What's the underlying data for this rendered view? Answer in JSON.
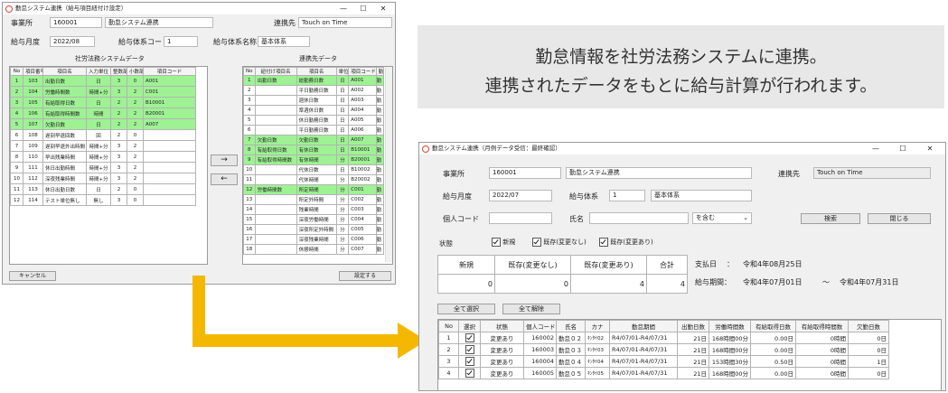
{
  "arrow_color": "#f5b800",
  "w1": {
    "title": "勤怠システム連携（給与項目紐付け設定）",
    "ctrls": [
      "—",
      "☐",
      "✕"
    ],
    "office_label": "事業所",
    "office_code": "160001",
    "office_name": "勤怠システム連携",
    "link_label": "連携先",
    "link_value": "Touch on Time",
    "month_label": "給与月度",
    "month_value": "2022/08",
    "sys_label": "給与体系コード",
    "sys_value": "1",
    "sysname_label": "給与体系名称",
    "sysname_value": "基本体系",
    "left_title": "社労法務システムデータ",
    "right_title": "連携先データ",
    "left_headers": [
      "No",
      "項目番号",
      "項目名",
      "入力単位",
      "整数部",
      "小数部",
      "項目コード"
    ],
    "left_rows": [
      {
        "no": "1",
        "num": "103",
        "name": "出勤日数",
        "unit": "日",
        "int": "3",
        "dec": "0",
        "code": "A001",
        "g": true
      },
      {
        "no": "2",
        "num": "104",
        "name": "労働時間数",
        "unit": "時間+分",
        "int": "3",
        "dec": "2",
        "code": "C001",
        "g": true
      },
      {
        "no": "3",
        "num": "105",
        "name": "有給取得日数",
        "unit": "日",
        "int": "2",
        "dec": "2",
        "code": "B10001",
        "g": true
      },
      {
        "no": "4",
        "num": "106",
        "name": "有給取得時間数",
        "unit": "時間",
        "int": "2",
        "dec": "2",
        "code": "B20001",
        "g": true
      },
      {
        "no": "5",
        "num": "107",
        "name": "欠勤日数",
        "unit": "日",
        "int": "2",
        "dec": "2",
        "code": "A007",
        "g": true
      },
      {
        "no": "6",
        "num": "108",
        "name": "遅刻早退回数",
        "unit": "回",
        "int": "2",
        "dec": "0",
        "code": "",
        "g": false
      },
      {
        "no": "7",
        "num": "109",
        "name": "遅刻早退外出時間",
        "unit": "時間+分",
        "int": "3",
        "dec": "2",
        "code": "",
        "g": false
      },
      {
        "no": "8",
        "num": "110",
        "name": "早出残業時間",
        "unit": "時間+分",
        "int": "3",
        "dec": "2",
        "code": "",
        "g": false
      },
      {
        "no": "9",
        "num": "111",
        "name": "休日出勤時間",
        "unit": "時間+分",
        "int": "3",
        "dec": "2",
        "code": "",
        "g": false
      },
      {
        "no": "10",
        "num": "112",
        "name": "深夜残業時間",
        "unit": "時間+分",
        "int": "3",
        "dec": "2",
        "code": "",
        "g": false
      },
      {
        "no": "11",
        "num": "113",
        "name": "休日出勤日数",
        "unit": "日",
        "int": "2",
        "dec": "0",
        "code": "",
        "g": false
      },
      {
        "no": "12",
        "num": "114",
        "name": "テスト単位無し",
        "unit": "無し",
        "int": "3",
        "dec": "0",
        "code": "",
        "g": false
      }
    ],
    "right_headers": [
      "No",
      "紐付け項目名",
      "項目名",
      "単位",
      "項目コード",
      "勤"
    ],
    "right_rows": [
      {
        "no": "1",
        "link": "出勤日数",
        "name": "総勤務日数",
        "unit": "日",
        "code": "A001",
        "x": "勤",
        "g": true
      },
      {
        "no": "2",
        "link": "",
        "name": "平日勤務日数",
        "unit": "日",
        "code": "A002",
        "x": "勤",
        "g": false
      },
      {
        "no": "3",
        "link": "",
        "name": "週休日数",
        "unit": "日",
        "code": "A003",
        "x": "勤",
        "g": false
      },
      {
        "no": "4",
        "link": "",
        "name": "準週休日数",
        "unit": "日",
        "code": "A004",
        "x": "勤",
        "g": false
      },
      {
        "no": "5",
        "link": "",
        "name": "休日勤務日数",
        "unit": "日",
        "code": "A005",
        "x": "勤",
        "g": false
      },
      {
        "no": "6",
        "link": "",
        "name": "平日勤務日数",
        "unit": "日",
        "code": "A006",
        "x": "勤",
        "g": false
      },
      {
        "no": "7",
        "link": "欠勤日数",
        "name": "欠勤日数",
        "unit": "日",
        "code": "A007",
        "x": "勤",
        "g": true
      },
      {
        "no": "8",
        "link": "有給取得日数",
        "name": "有休日数",
        "unit": "日",
        "code": "B10001",
        "x": "勤",
        "g": true
      },
      {
        "no": "9",
        "link": "有給取得時間数",
        "name": "有休時間",
        "unit": "分",
        "code": "B20001",
        "x": "勤",
        "g": true
      },
      {
        "no": "10",
        "link": "",
        "name": "代休日数",
        "unit": "日",
        "code": "B10002",
        "x": "勤",
        "g": false
      },
      {
        "no": "11",
        "link": "",
        "name": "代休時間",
        "unit": "分",
        "code": "B20002",
        "x": "勤",
        "g": false
      },
      {
        "no": "12",
        "link": "労働時間数",
        "name": "所定時間",
        "unit": "分",
        "code": "C001",
        "x": "勤",
        "g": true
      },
      {
        "no": "13",
        "link": "",
        "name": "所定外時間",
        "unit": "分",
        "code": "C002",
        "x": "勤",
        "g": false
      },
      {
        "no": "14",
        "link": "",
        "name": "残業時間",
        "unit": "分",
        "code": "C003",
        "x": "勤",
        "g": false
      },
      {
        "no": "15",
        "link": "",
        "name": "深夜労働時間",
        "unit": "分",
        "code": "C004",
        "x": "勤",
        "g": false
      },
      {
        "no": "16",
        "link": "",
        "name": "深夜所定外時間",
        "unit": "分",
        "code": "C005",
        "x": "勤",
        "g": false
      },
      {
        "no": "17",
        "link": "",
        "name": "深夜残業時間",
        "unit": "分",
        "code": "C006",
        "x": "勤",
        "g": false
      },
      {
        "no": "18",
        "link": "",
        "name": "休憩時間",
        "unit": "分",
        "code": "C007",
        "x": "勤",
        "g": false
      }
    ],
    "move_right": "→",
    "move_left": "←",
    "cancel_label": "キャンセル",
    "save_label": "設定する"
  },
  "callout": {
    "line1": "勤怠情報を社労法務システムに連携。",
    "line2": "連携されたデータをもとに給与計算が行われます。"
  },
  "w2": {
    "title": "勤怠システム連携（月例データ受信：最終確認）",
    "ctrls": [
      "—",
      "☐",
      "✕"
    ],
    "office_label": "事業所",
    "office_code": "160001",
    "office_name": "勤怠システム連携",
    "link_label": "連携先",
    "link_value": "Touch on Time",
    "month_label": "給与月度",
    "month_value": "2022/07",
    "sys_label": "給与体系",
    "sys_value": "1",
    "sys_name": "基本体系",
    "person_label": "個人コード",
    "name_label": "氏名",
    "match_value": "を含む",
    "search_label": "検索",
    "close_label": "閉じる",
    "status_label": "状態",
    "checks": [
      "新規",
      "既存(変更なし)",
      "既存(変更あり)"
    ],
    "summary_headers": [
      "新規",
      "既存(変更なし)",
      "既存(変更あり)",
      "合計"
    ],
    "summary_values": [
      "0",
      "0",
      "4",
      "4"
    ],
    "pay_label": "支払日",
    "pay_colon": "：",
    "pay_value": "令和4年08月25日",
    "period_label": "給与期間：",
    "period_from": "令和4年07月01日",
    "period_tilde": "〜",
    "period_to": "令和4年07月31日",
    "select_all": "全て選択",
    "clear_all": "全て解除",
    "headers": [
      "No",
      "選択",
      "状態",
      "個人コード",
      "氏名",
      "カナ",
      "勤怠期間",
      "出勤日数",
      "労働時間数",
      "有給取得日数",
      "有給取得時間数",
      "欠勤日数"
    ],
    "rows": [
      {
        "no": "1",
        "status": "変更あり",
        "code": "160002",
        "name": "勤怠０２",
        "kana": "ｷﾝﾀｲ02",
        "period": "R4/07/01-R4/07/31",
        "days": "21日",
        "hours": "168時間00分",
        "paid": "0.00日",
        "paidh": "0時間",
        "absent": "0日"
      },
      {
        "no": "2",
        "status": "変更あり",
        "code": "160003",
        "name": "勤怠０３",
        "kana": "ｷﾝﾀｲ03",
        "period": "R4/07/01-R4/07/31",
        "days": "21日",
        "hours": "168時間00分",
        "paid": "0.00日",
        "paidh": "0時間",
        "absent": "0日"
      },
      {
        "no": "3",
        "status": "変更あり",
        "code": "160004",
        "name": "勤怠０４",
        "kana": "ｷﾝﾀｲ04",
        "period": "R4/07/01-R4/07/31",
        "days": "21日",
        "hours": "153時間30分",
        "paid": "0.50日",
        "paidh": "0時間",
        "absent": "1日"
      },
      {
        "no": "4",
        "status": "変更あり",
        "code": "160005",
        "name": "勤怠０５",
        "kana": "ｷﾝﾀｲ05",
        "period": "R4/07/01-R4/07/31",
        "days": "21日",
        "hours": "168時間00分",
        "paid": "0.00日",
        "paidh": "0時間",
        "absent": "0日"
      }
    ]
  }
}
